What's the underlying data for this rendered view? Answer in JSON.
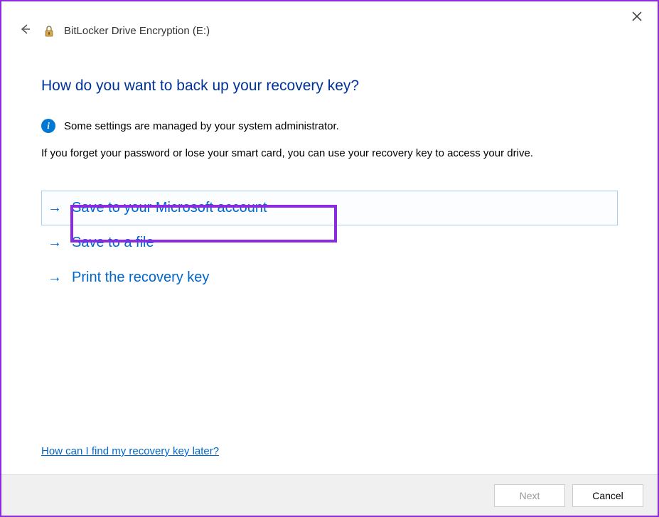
{
  "header": {
    "title": "BitLocker Drive Encryption (E:)"
  },
  "main": {
    "heading": "How do you want to back up your recovery key?",
    "info_text": "Some settings are managed by your system administrator.",
    "description": "If you forget your password or lose your smart card, you can use your recovery key to access your drive."
  },
  "options": {
    "save_ms_account": "Save to your Microsoft account",
    "save_file": "Save to a file",
    "print_key": "Print the recovery key"
  },
  "help_link": "How can I find my recovery key later?",
  "footer": {
    "next": "Next",
    "cancel": "Cancel"
  }
}
